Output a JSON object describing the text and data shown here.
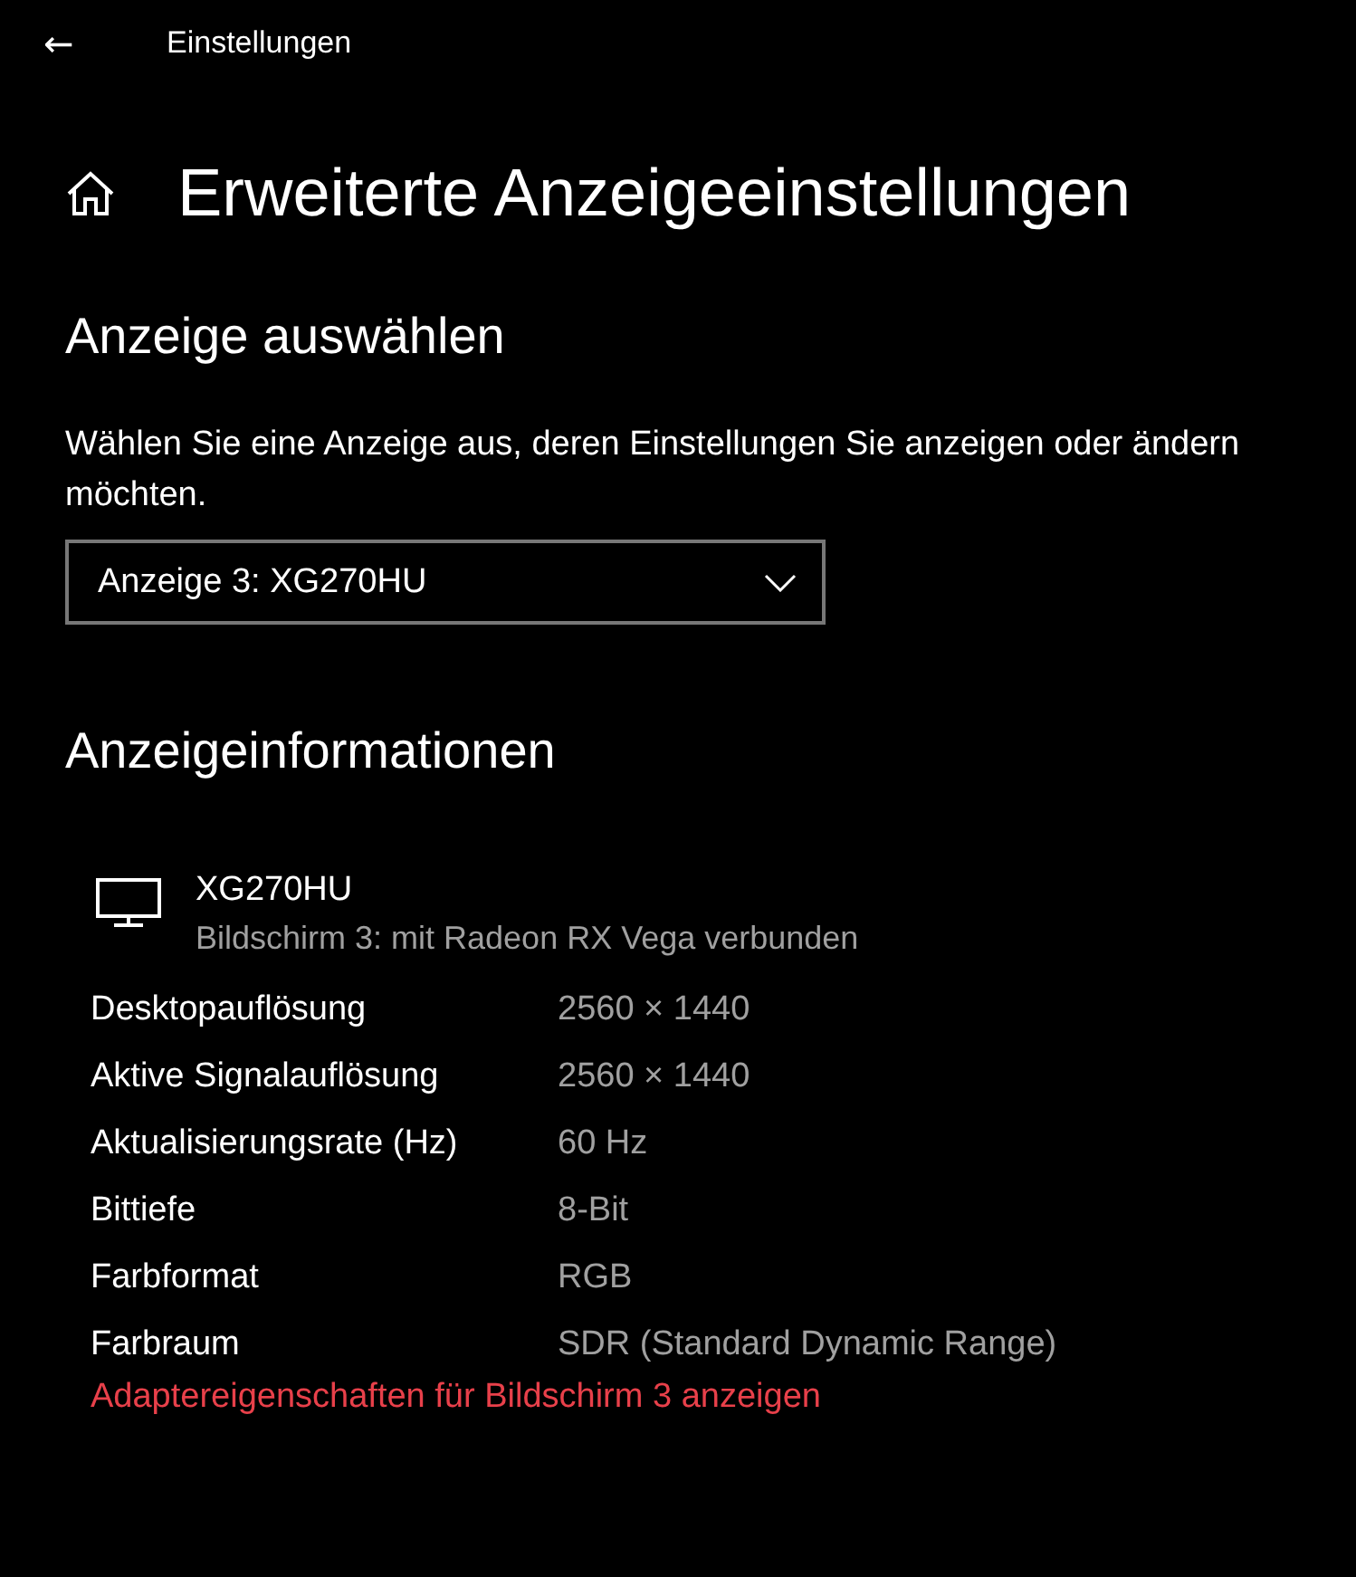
{
  "header": {
    "back_label": "←",
    "title": "Einstellungen"
  },
  "page_title": "Erweiterte Anzeigeeinstellungen",
  "select_section": {
    "heading": "Anzeige auswählen",
    "description": "Wählen Sie eine Anzeige aus, deren Einstellungen Sie anzeigen oder ändern möchten.",
    "dropdown": {
      "value": "Anzeige 3: XG270HU"
    }
  },
  "info_section": {
    "heading": "Anzeigeinformationen",
    "display_name": "XG270HU",
    "display_subtitle": "Bildschirm 3: mit Radeon RX Vega verbunden",
    "rows": [
      {
        "label": "Desktopauflösung",
        "value": "2560 × 1440"
      },
      {
        "label": "Aktive Signalauflösung",
        "value": "2560 × 1440"
      },
      {
        "label": "Aktualisierungsrate (Hz)",
        "value": "60 Hz"
      },
      {
        "label": "Bittiefe",
        "value": "8-Bit"
      },
      {
        "label": "Farbformat",
        "value": "RGB"
      },
      {
        "label": "Farbraum",
        "value": "SDR (Standard Dynamic Range)"
      }
    ],
    "link": "Adaptereigenschaften für Bildschirm 3 anzeigen"
  }
}
